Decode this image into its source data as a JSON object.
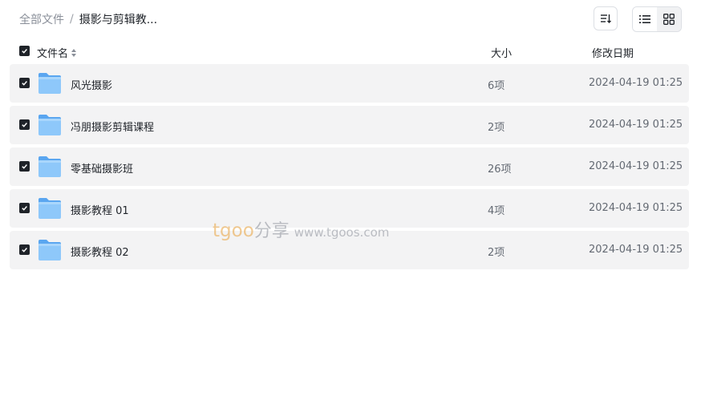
{
  "breadcrumb": {
    "root": "全部文件",
    "separator": "/",
    "current": "摄影与剪辑教..."
  },
  "toolbar": {
    "sort_icon": "sort-icon",
    "list_view_icon": "list-view-icon",
    "grid_view_icon": "grid-view-icon"
  },
  "table": {
    "headers": {
      "name": "文件名",
      "size": "大小",
      "date": "修改日期"
    },
    "rows": [
      {
        "name": "风光摄影",
        "size": "6项",
        "date": "2024-04-19 01:25",
        "checked": true
      },
      {
        "name": "冯朋摄影剪辑课程",
        "size": "2项",
        "date": "2024-04-19 01:25",
        "checked": true
      },
      {
        "name": "零基础摄影班",
        "size": "26项",
        "date": "2024-04-19 01:25",
        "checked": true
      },
      {
        "name": "摄影教程 01",
        "size": "4项",
        "date": "2024-04-19 01:25",
        "checked": true
      },
      {
        "name": "摄影教程 02",
        "size": "2项",
        "date": "2024-04-19 01:25",
        "checked": true
      }
    ]
  },
  "watermark": {
    "brand": "tgoo",
    "brand_suffix": "分享",
    "url": "www.tgoos.com"
  },
  "colors": {
    "row_bg": "#f3f3f4",
    "checkbox": "#1f2329",
    "folder": "#6fb5f5"
  }
}
